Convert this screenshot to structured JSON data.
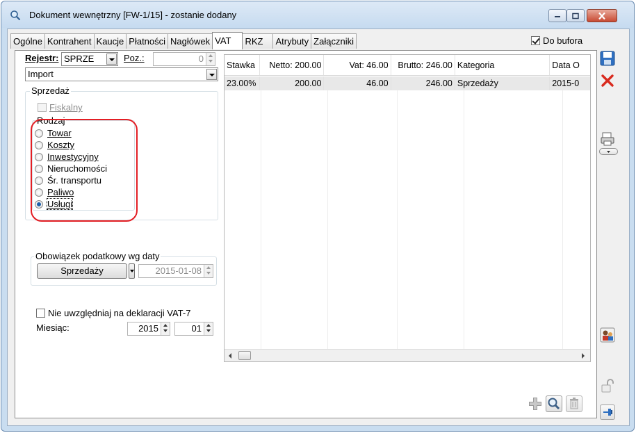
{
  "window": {
    "title": "Dokument wewnętrzny [FW-1/15]  - zostanie dodany"
  },
  "tabs": [
    {
      "label": "Ogólne"
    },
    {
      "label": "Kontrahent"
    },
    {
      "label": "Kaucje"
    },
    {
      "label": "Płatności"
    },
    {
      "label": "Nagłówek"
    },
    {
      "label": "VAT"
    },
    {
      "label": "RKZ"
    },
    {
      "label": "Atrybuty"
    },
    {
      "label": "Załączniki"
    }
  ],
  "active_tab": "VAT",
  "do_bufora": {
    "label": "Do bufora",
    "checked": true
  },
  "form": {
    "rejestr_label": "Rejestr:",
    "rejestr_value": "SPRZE",
    "poz_label": "Poz.:",
    "poz_value": "0",
    "import_value": "Import",
    "sprzedaz_group": "Sprzedaż",
    "fiskalny_label": "Fiskalny",
    "rodzaj_group": "Rodzaj",
    "rodzaj_options": [
      "Towar",
      "Koszty",
      "Inwestycyjny",
      "Nieruchomości",
      "Śr. transportu",
      "Paliwo",
      "Usługi"
    ],
    "rodzaj_selected": "Usługi",
    "obowiazek_group": "Obowiązek podatkowy wg daty",
    "obowiazek_button": "Sprzedaży",
    "obowiazek_date": "2015-01-08",
    "nie_uwzgledniaj_label": "Nie uwzględniaj na deklaracji VAT-7",
    "miesiac_label": "Miesiąc:",
    "miesiac_year": "2015",
    "miesiac_month": "01"
  },
  "grid": {
    "headers": [
      "Stawka",
      "Netto: 200.00",
      "Vat: 46.00",
      "Brutto: 246.00",
      "Kategoria",
      "Data O"
    ],
    "rows": [
      [
        "23.00%",
        "200.00",
        "46.00",
        "246.00",
        "Sprzedaży",
        "2015-0"
      ]
    ]
  },
  "colors": {
    "highlight": "#e31e24",
    "window_frame": "#c9ddf0",
    "selected_radio": "#1c5ea8"
  },
  "icons": [
    "search-window-icon",
    "minimize-icon",
    "maximize-icon",
    "close-icon",
    "save-icon",
    "cancel-icon",
    "print-icon",
    "dropdown-arrow-icon",
    "contractor-icon",
    "unlock-icon",
    "pin-icon",
    "add-icon",
    "preview-icon",
    "delete-icon"
  ]
}
